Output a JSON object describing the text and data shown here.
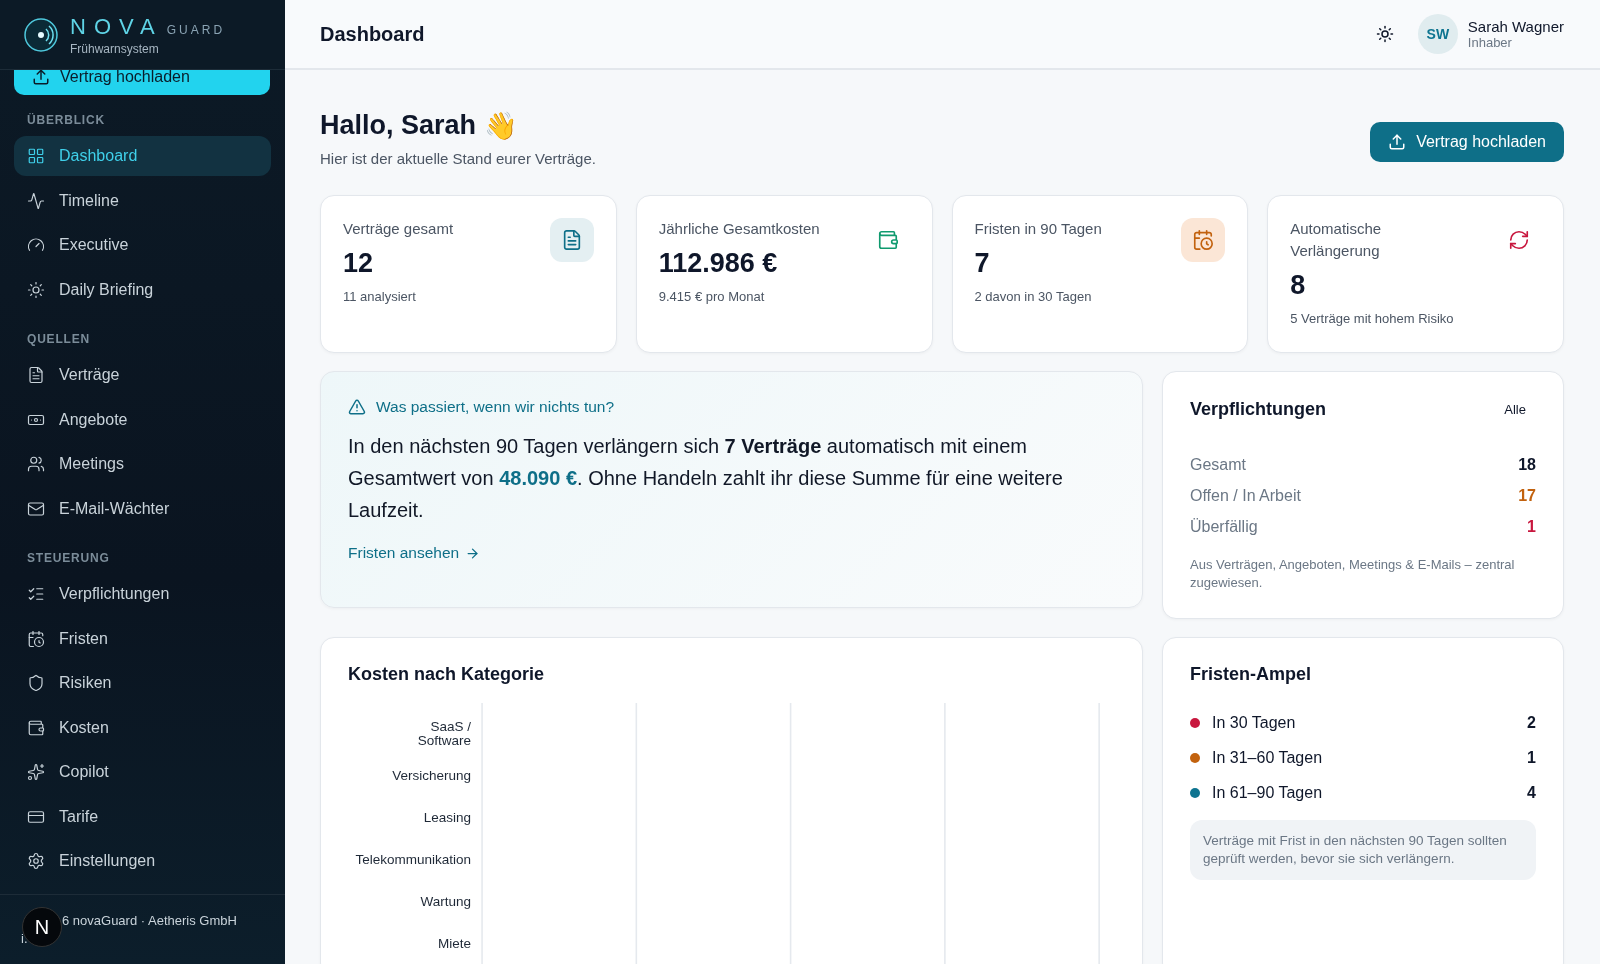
{
  "brand": {
    "name": "NOVA",
    "suffix": "GUARD",
    "tagline": "Frühwarnsystem"
  },
  "sidebar": {
    "upload_button": "Vertrag hochladen",
    "sections": [
      {
        "title": "ÜBERBLICK",
        "items": [
          {
            "label": "Dashboard",
            "selected": true
          },
          {
            "label": "Timeline",
            "selected": false
          },
          {
            "label": "Executive",
            "selected": false
          },
          {
            "label": "Daily Briefing",
            "selected": false
          }
        ]
      },
      {
        "title": "QUELLEN",
        "items": [
          {
            "label": "Verträge",
            "selected": false
          },
          {
            "label": "Angebote",
            "selected": false
          },
          {
            "label": "Meetings",
            "selected": false
          },
          {
            "label": "E-Mail-Wächter",
            "selected": false
          }
        ]
      },
      {
        "title": "STEUERUNG",
        "items": [
          {
            "label": "Verpflichtungen",
            "selected": false
          },
          {
            "label": "Fristen",
            "selected": false
          },
          {
            "label": "Risiken",
            "selected": false
          },
          {
            "label": "Kosten",
            "selected": false
          },
          {
            "label": "Copilot",
            "selected": false
          },
          {
            "label": "Tarife",
            "selected": false
          },
          {
            "label": "Einstellungen",
            "selected": false
          }
        ]
      }
    ],
    "footer": {
      "badge": "N",
      "text": "6 novaGuard · Aetheris GmbH",
      "text_2": "i."
    }
  },
  "header": {
    "title": "Dashboard",
    "user": {
      "initials": "SW",
      "name": "Sarah Wagner",
      "role": "Inhaber"
    }
  },
  "greeting": {
    "title": "Hallo, Sarah",
    "emoji": "👋",
    "subtitle": "Hier ist der aktuelle Stand eurer Verträge.",
    "button": "Vertrag hochladen"
  },
  "stats": [
    {
      "kind": "document",
      "label": "Verträge gesamt",
      "value": "12",
      "note": "11 analysiert"
    },
    {
      "kind": "wallet",
      "label": "Jährliche Gesamtkosten",
      "value": "112.986 €",
      "note": "9.415 € pro Monat"
    },
    {
      "kind": "calendar",
      "label": "Fristen in 90 Tagen",
      "value": "7",
      "note": "2 davon in 30 Tagen"
    },
    {
      "kind": "renew",
      "label": "Automatische Verlängerung",
      "value": "8",
      "note": "5 Verträge mit hohem Risiko"
    }
  ],
  "alert": {
    "title": "Was passiert, wenn wir nichts tun?",
    "segments": [
      {
        "text": "In den nächsten 90 Tagen verlängern sich ",
        "kind": "plain"
      },
      {
        "text": "7 Verträge",
        "kind": "bold"
      },
      {
        "text": " automatisch mit einem Gesamtwert von ",
        "kind": "plain"
      },
      {
        "text": "48.090 €",
        "kind": "highlight"
      },
      {
        "text": ". Ohne Handeln zahlt ihr diese Summe für eine weitere Laufzeit.",
        "kind": "plain"
      }
    ],
    "link": "Fristen ansehen"
  },
  "obligations": {
    "title": "Verpflichtungen",
    "link": "Alle",
    "rows": [
      {
        "label": "Gesamt",
        "value": "18",
        "color": "#0f172a"
      },
      {
        "label": "Offen / In Arbeit",
        "value": "17",
        "color": "#c2620e"
      },
      {
        "label": "Überfällig",
        "value": "1",
        "color": "#c8173e"
      }
    ],
    "note": "Aus Verträgen, Angeboten, Meetings & E-Mails – zentral zugewiesen."
  },
  "cost_chart": {
    "title": "Kosten nach Kategorie",
    "categories": [
      "SaaS / Software",
      "Versicherung",
      "Leasing",
      "Telekommunikation",
      "Wartung",
      "Miete"
    ]
  },
  "deadlines": {
    "title": "Fristen-Ampel",
    "rows": [
      {
        "label": "In 30 Tagen",
        "value": "2",
        "color": "#c8173e"
      },
      {
        "label": "In 31–60 Tagen",
        "value": "1",
        "color": "#c2620e"
      },
      {
        "label": "In 61–90 Tagen",
        "value": "4",
        "color": "#0e7490"
      }
    ],
    "note": "Verträge mit Frist in den nächsten 90 Tagen sollten geprüft werden, bevor sie sich verlängern."
  }
}
